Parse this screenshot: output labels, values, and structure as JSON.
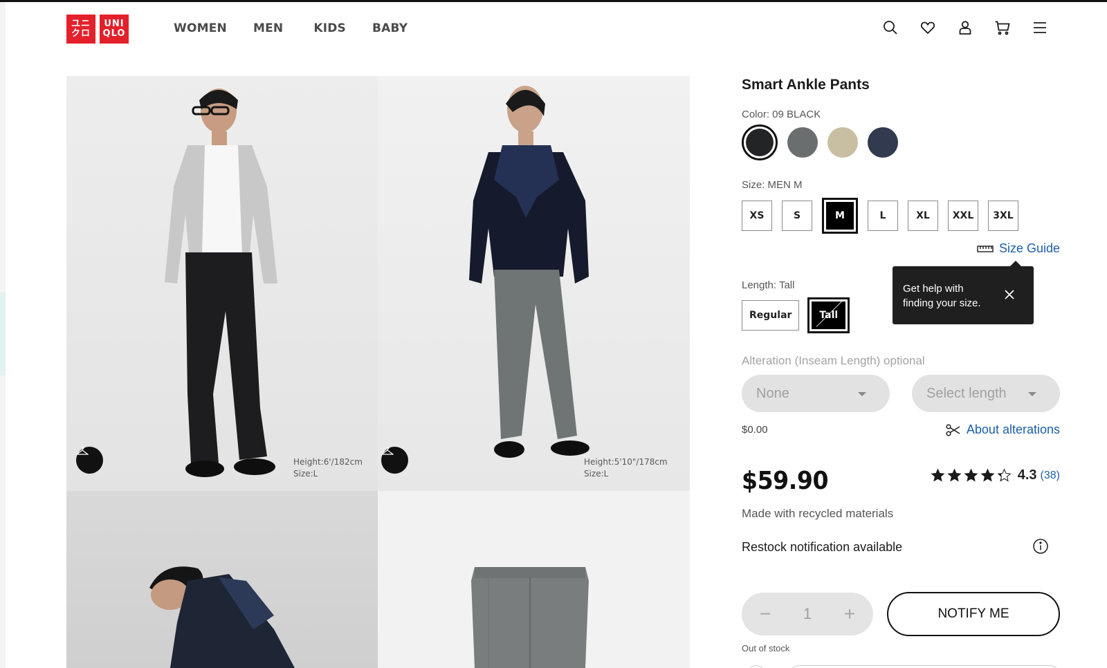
{
  "header": {
    "logo_top": "UNI",
    "logo_bottom": "QLO",
    "logo_top_katakana": "ユニ",
    "logo_bottom_katakana": "クロ",
    "nav": [
      "WOMEN",
      "MEN",
      "KIDS",
      "BABY"
    ],
    "icons": [
      "search-icon",
      "heart-icon",
      "user-icon",
      "cart-icon",
      "menu-icon"
    ]
  },
  "gallery": {
    "photos": [
      {
        "model_height": "Height:6'/182cm",
        "model_size": "Size:L"
      },
      {
        "model_height": "Height:5'10\"/178cm",
        "model_size": "Size:L"
      },
      {},
      {}
    ]
  },
  "product": {
    "name": "Smart Ankle Pants",
    "color_label": "Color: 09 BLACK",
    "colors": [
      {
        "hex": "#222425",
        "selected": true
      },
      {
        "hex": "#6a6e6e",
        "selected": false
      },
      {
        "hex": "#c8bea2",
        "selected": false
      },
      {
        "hex": "#313a4e",
        "selected": false
      }
    ],
    "size_label": "Size: MEN M",
    "sizes": [
      "XS",
      "S",
      "M",
      "L",
      "XL",
      "XXL",
      "3XL"
    ],
    "selected_size": "M",
    "size_guide": "Size Guide",
    "tooltip": "Get help with finding your size.",
    "length_label": "Length: Tall",
    "lengths": [
      "Regular",
      "Tall"
    ],
    "selected_length": "Tall",
    "alteration_label": "Alteration (Inseam Length) optional",
    "alteration_type": "None",
    "alteration_length_placeholder": "Select length",
    "alteration_price": "$0.00",
    "about_alterations": "About alterations",
    "price": "$59.90",
    "rating": "4.3",
    "rating_value": 4.3,
    "review_count": "(38)",
    "recycled": "Made with recycled materials",
    "restock": "Restock notification available",
    "quantity": "1",
    "notify_button": "NOTIFY ME",
    "stock_status": "Out of stock"
  },
  "colors": {
    "brand_red": "#e4202a",
    "link_blue": "#1b5fa8",
    "tooltip_bg": "#1f1f1f"
  }
}
